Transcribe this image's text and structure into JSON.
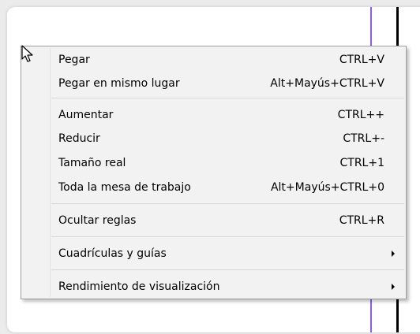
{
  "menu": {
    "items": [
      {
        "label": "Pegar",
        "shortcut": "CTRL+V"
      },
      {
        "label": "Pegar en mismo lugar",
        "shortcut": "Alt+Mayús+CTRL+V"
      },
      {
        "label": "Aumentar",
        "shortcut": "CTRL++"
      },
      {
        "label": "Reducir",
        "shortcut": "CTRL+-"
      },
      {
        "label": "Tamaño real",
        "shortcut": "CTRL+1"
      },
      {
        "label": "Toda la mesa de trabajo",
        "shortcut": "Alt+Mayús+CTRL+0"
      },
      {
        "label": "Ocultar reglas",
        "shortcut": "CTRL+R"
      },
      {
        "label": "Cuadrículas y guías",
        "shortcut": ""
      },
      {
        "label": "Rendimiento de visualización",
        "shortcut": ""
      }
    ]
  },
  "colors": {
    "guide": "#8a5cf0",
    "menu_bg": "#f2f2f2",
    "menu_border": "#a0a0a0"
  },
  "icons": {
    "cursor": "arrow-cursor-icon",
    "submenu": "submenu-arrow-icon"
  }
}
